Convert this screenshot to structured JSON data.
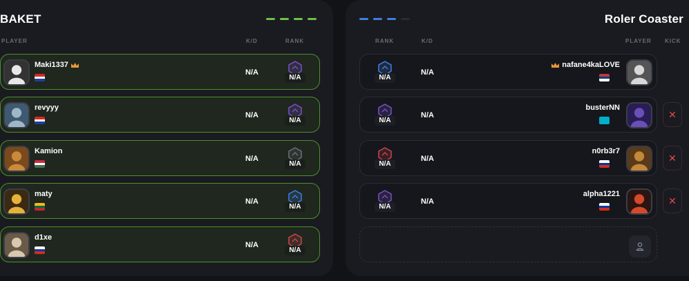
{
  "colors": {
    "left_accent": "#6cc24a",
    "right_accent": "#3f7fe0",
    "kick": "#e04848"
  },
  "left": {
    "team_name": "BAKET",
    "headers": {
      "player": "PLAYER",
      "kd": "K/D",
      "rank": "RANK"
    },
    "players": [
      {
        "name": "Maki1337",
        "leader": true,
        "flag": "croatia-flag",
        "kd": "N/A",
        "rank": "N/A",
        "rank_color": "purple"
      },
      {
        "name": "revyyy",
        "leader": false,
        "flag": "croatia-flag",
        "kd": "N/A",
        "rank": "N/A",
        "rank_color": "purple"
      },
      {
        "name": "Kamion",
        "leader": false,
        "flag": "hungary-flag",
        "kd": "N/A",
        "rank": "N/A",
        "rank_color": "gray"
      },
      {
        "name": "maty",
        "leader": false,
        "flag": "lithuania-flag",
        "kd": "N/A",
        "rank": "N/A",
        "rank_color": "blue"
      },
      {
        "name": "d1xe",
        "leader": false,
        "flag": "russia-flag",
        "kd": "N/A",
        "rank": "N/A",
        "rank_color": "red"
      }
    ]
  },
  "right": {
    "team_name": "Roler Coaster",
    "headers": {
      "rank": "RANK",
      "kd": "K/D",
      "player": "PLAYER",
      "kick": "KICK"
    },
    "players": [
      {
        "name": "nafane4kaLOVE",
        "leader": true,
        "flag": "serbia-flag",
        "kd": "N/A",
        "rank": "N/A",
        "rank_color": "blue",
        "kick": false
      },
      {
        "name": "busterNN",
        "leader": false,
        "flag": "kazakhstan-flag",
        "kd": "N/A",
        "rank": "N/A",
        "rank_color": "purple",
        "kick": true
      },
      {
        "name": "n0rb3r7",
        "leader": false,
        "flag": "russia-flag",
        "kd": "N/A",
        "rank": "N/A",
        "rank_color": "red",
        "kick": true
      },
      {
        "name": "alpha1221",
        "leader": false,
        "flag": "russia-flag",
        "kd": "N/A",
        "rank": "N/A",
        "rank_color": "purple",
        "kick": true
      }
    ],
    "kick_symbol": "✕",
    "empty_slot_icon": "user-icon"
  }
}
